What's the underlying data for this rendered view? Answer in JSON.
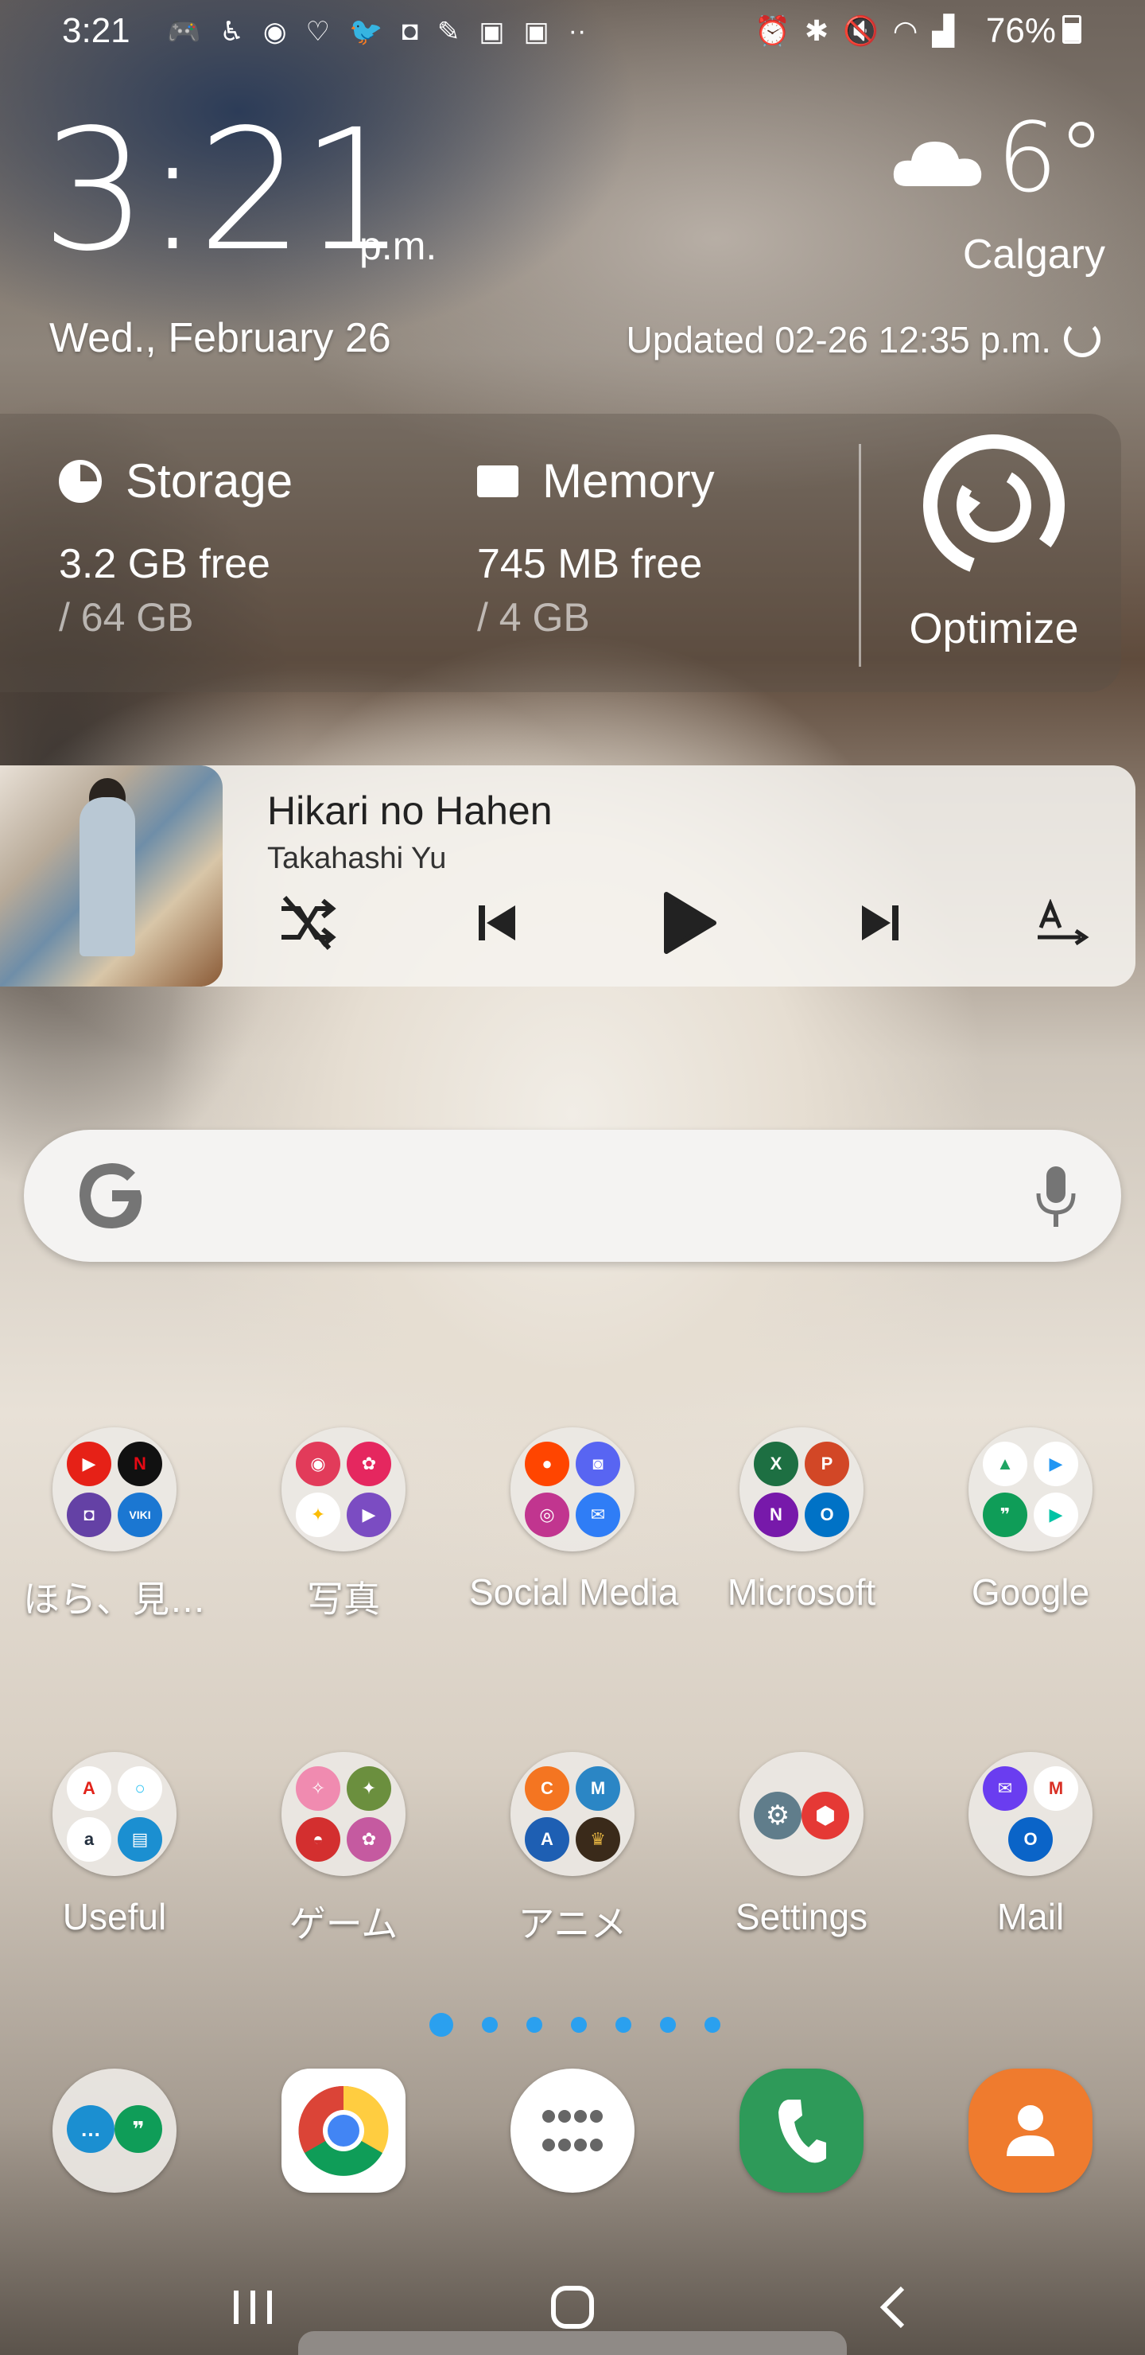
{
  "status_bar": {
    "time": "3:21",
    "battery": "76%",
    "left_icons": [
      "game-icon",
      "accessibility-icon",
      "messenger-icon",
      "health-icon",
      "twitter-icon",
      "twitch-icon",
      "feather-icon",
      "ge-icon",
      "ge-icon",
      "more-icon"
    ],
    "right_icons": [
      "alarm-icon",
      "bluetooth-icon",
      "mute-icon",
      "wifi-icon",
      "signal-icon"
    ]
  },
  "clock": {
    "time": "3:21",
    "ampm": "p.m.",
    "date": "Wed., February 26"
  },
  "weather": {
    "temp": "6°",
    "city": "Calgary",
    "updated": "Updated 02-26 12:35 p.m."
  },
  "device_care": {
    "storage": {
      "label": "Storage",
      "free": "3.2 GB free",
      "total": "/ 64 GB"
    },
    "memory": {
      "label": "Memory",
      "free": "745 MB free",
      "total": "/ 4 GB"
    },
    "optimize": "Optimize"
  },
  "music": {
    "title": "Hikari no Hahen",
    "artist": "Takahashi Yu"
  },
  "apps_row1": [
    {
      "label": "ほら、見…",
      "minis": [
        {
          "t": "▶",
          "c": "#e62117"
        },
        {
          "t": "N",
          "c": "#111111"
        },
        {
          "t": "◘",
          "c": "#6441a5"
        },
        {
          "t": "VIKI",
          "c": "#1b77d2"
        }
      ]
    },
    {
      "label": "写真",
      "minis": [
        {
          "t": "◉",
          "c": "#e23b5a"
        },
        {
          "t": "✿",
          "c": "#e5275f"
        },
        {
          "t": "✦",
          "c": "#fbbc05"
        },
        {
          "t": "▶",
          "c": "#7b4cc2"
        }
      ]
    },
    {
      "label": "Social Media",
      "minis": [
        {
          "t": "●",
          "c": "#ff4500"
        },
        {
          "t": "◙",
          "c": "#5865f2"
        },
        {
          "t": "◎",
          "c": "#c1358f"
        },
        {
          "t": "✉",
          "c": "#2f7df6"
        }
      ]
    },
    {
      "label": "Microsoft",
      "minis": [
        {
          "t": "X",
          "c": "#1d6f42"
        },
        {
          "t": "P",
          "c": "#d24726"
        },
        {
          "t": "N",
          "c": "#7719aa"
        },
        {
          "t": "O",
          "c": "#0072c6"
        }
      ]
    },
    {
      "label": "Google",
      "minis": [
        {
          "t": "▲",
          "c": "#1fa463"
        },
        {
          "t": "▶",
          "c": "#2196f3"
        },
        {
          "t": "❞",
          "c": "#0f9d58"
        },
        {
          "t": "▶",
          "c": "#00c3a5"
        }
      ]
    }
  ],
  "apps_row2": [
    {
      "label": "Useful",
      "minis": [
        {
          "t": "A",
          "c": "#e2231a"
        },
        {
          "t": "○",
          "c": "#31c4f3"
        },
        {
          "t": "a",
          "c": "#232f3e"
        },
        {
          "t": "▤",
          "c": "#1b8fd1"
        }
      ]
    },
    {
      "label": "ゲーム",
      "minis": [
        {
          "t": "✧",
          "c": "#f08bb0"
        },
        {
          "t": "✦",
          "c": "#6b8f3e"
        },
        {
          "t": "◓",
          "c": "#d32f2f"
        },
        {
          "t": "✿",
          "c": "#c55aa0"
        }
      ]
    },
    {
      "label": "アニメ",
      "minis": [
        {
          "t": "C",
          "c": "#f47521"
        },
        {
          "t": "M",
          "c": "#2b86c5"
        },
        {
          "t": "A",
          "c": "#1e5fb3"
        },
        {
          "t": "♛",
          "c": "#3a2a1a"
        }
      ]
    },
    {
      "label": "Settings",
      "minis": [
        {
          "t": "⚙",
          "c": "#607d8b"
        },
        {
          "t": "⬢",
          "c": "#e53935"
        }
      ]
    },
    {
      "label": "Mail",
      "minis": [
        {
          "t": "✉",
          "c": "#6a3df0"
        },
        {
          "t": "M",
          "c": "#d93025"
        },
        {
          "t": "O",
          "c": "#0a64c8"
        }
      ]
    }
  ],
  "nav": {
    "recents": "|||",
    "home": "○",
    "back": "<"
  }
}
